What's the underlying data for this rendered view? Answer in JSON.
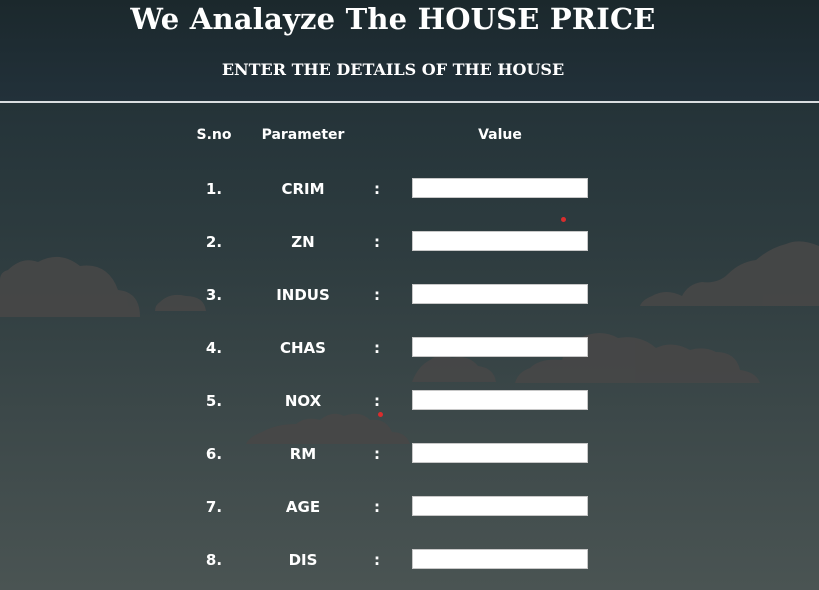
{
  "header": {
    "title": "We Analayze The HOUSE PRICE",
    "subtitle": "ENTER THE DETAILS OF THE HOUSE"
  },
  "table": {
    "columns": {
      "sno": "S.no",
      "parameter": "Parameter",
      "value": "Value"
    },
    "separator": ":",
    "rows": [
      {
        "sno": "1.",
        "parameter": "CRIM",
        "value": ""
      },
      {
        "sno": "2.",
        "parameter": "ZN",
        "value": ""
      },
      {
        "sno": "3.",
        "parameter": "INDUS",
        "value": ""
      },
      {
        "sno": "4.",
        "parameter": "CHAS",
        "value": ""
      },
      {
        "sno": "5.",
        "parameter": "NOX",
        "value": ""
      },
      {
        "sno": "6.",
        "parameter": "RM",
        "value": ""
      },
      {
        "sno": "7.",
        "parameter": "AGE",
        "value": ""
      },
      {
        "sno": "8.",
        "parameter": "DIS",
        "value": ""
      }
    ]
  },
  "colors": {
    "background_top": "#1d2a2e",
    "background_bottom": "#4a5453",
    "cloud": "#4a4a4a",
    "accent_dot": "#d92d2d"
  }
}
